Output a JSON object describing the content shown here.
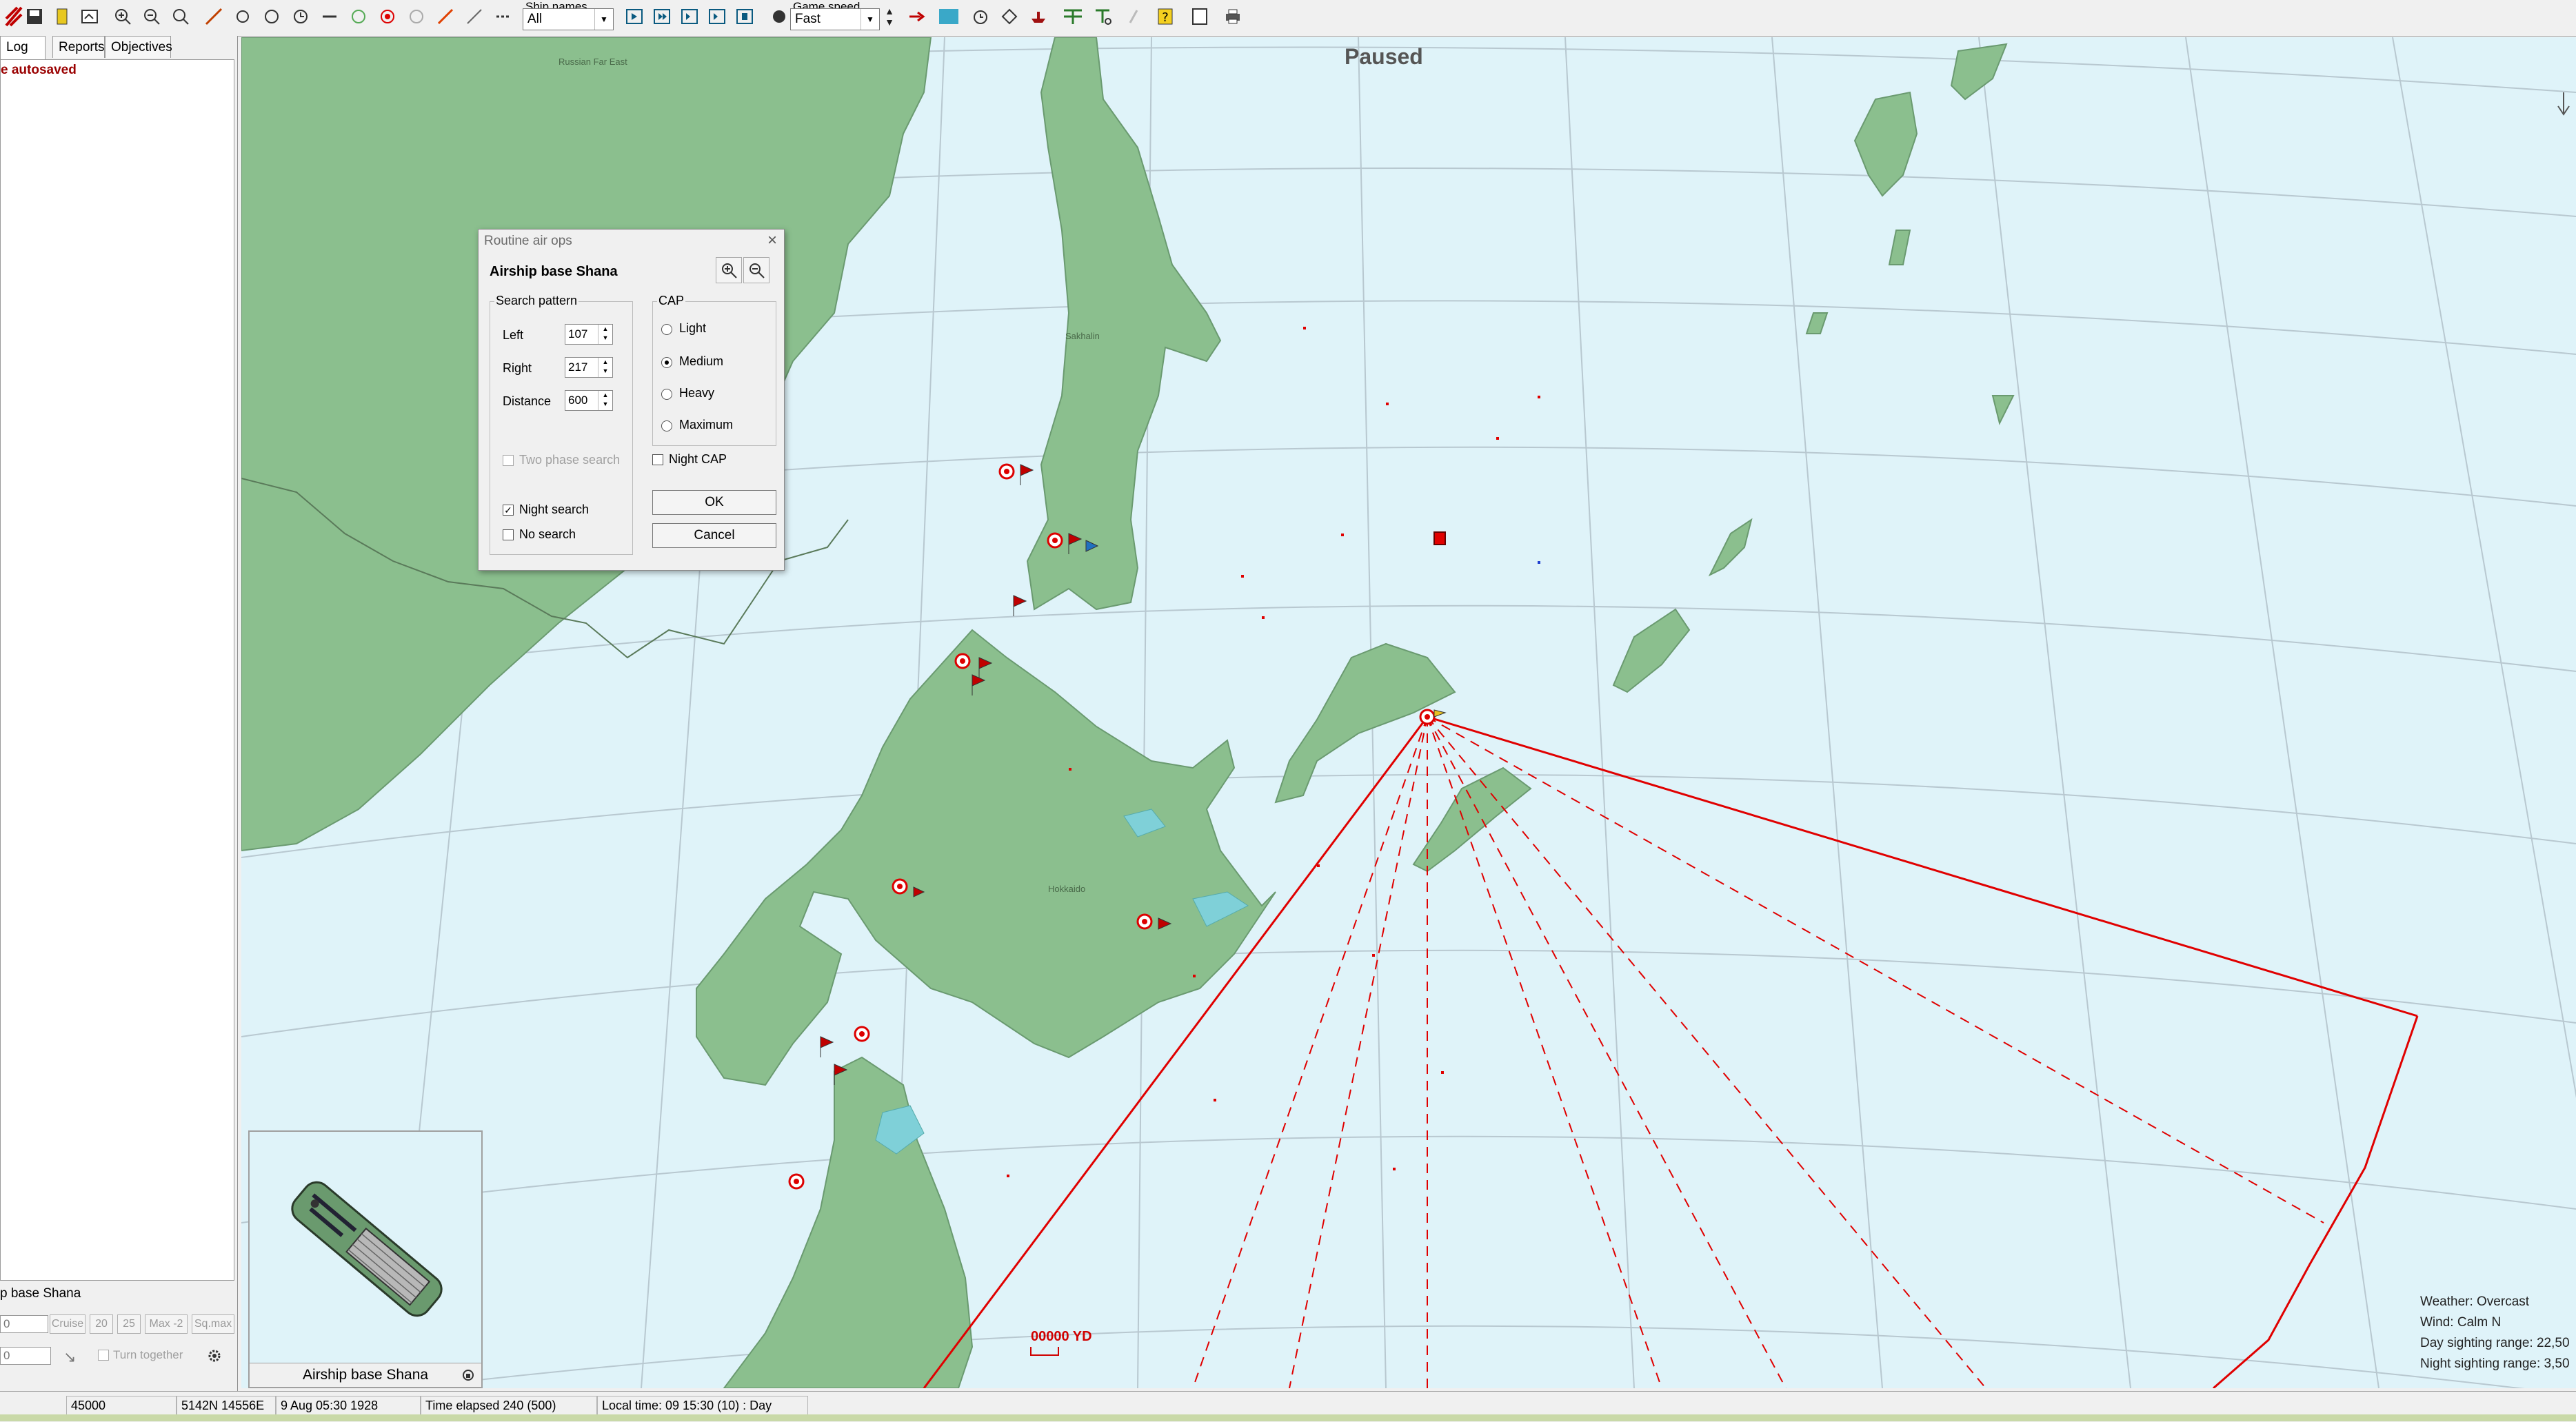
{
  "toolbar": {
    "ship_names_label": "Ship names",
    "ship_names_value": "All",
    "game_speed_label": "Game speed",
    "game_speed_value": "Fast"
  },
  "left_panel": {
    "tabs": [
      {
        "label": "Log",
        "active": true
      },
      {
        "label": "Reports",
        "active": false
      },
      {
        "label": "Objectives",
        "active": false
      }
    ],
    "log_line": "e autosaved",
    "unit_name": "p base Shana",
    "controls": {
      "speed_value": "0",
      "cruise_label": "Cruise",
      "b20_label": "20",
      "b25_label": "25",
      "max_label": "Max -2",
      "sqmax_label": "Sq.max",
      "heading_value": "0",
      "turn_together_label": "Turn together"
    }
  },
  "map": {
    "paused_label": "Paused",
    "region_label_far_east": "Russian Far East",
    "region_label_sakhalin": "Sakhalin",
    "region_label_hokkaido": "Hokkaido",
    "scale_label": "00000 YD",
    "weather": {
      "weather": "Weather: Overcast",
      "wind": "Wind: Calm  N",
      "day_sighting": "Day sighting range: 22,50",
      "night_sighting": "Night sighting range: 3,50"
    }
  },
  "thumbnail": {
    "label": "Airship base Shana"
  },
  "dialog": {
    "title": "Routine air ops",
    "header": "Airship base Shana",
    "search_pattern": {
      "label": "Search pattern",
      "left_label": "Left",
      "left_value": "107",
      "right_label": "Right",
      "right_value": "217",
      "distance_label": "Distance",
      "distance_value": "600"
    },
    "cap": {
      "label": "CAP",
      "options": [
        "Light",
        "Medium",
        "Heavy",
        "Maximum"
      ],
      "selected": "Medium"
    },
    "two_phase_search_label": "Two phase search",
    "night_cap_label": "Night CAP",
    "night_search_label": "Night search",
    "no_search_label": "No search",
    "ok_label": "OK",
    "cancel_label": "Cancel"
  },
  "statusbar": {
    "value": "45000",
    "coords": "5142N 14556E",
    "date": "9 Aug 05:30 1928",
    "elapsed": "Time elapsed 240 (500)",
    "local_time": "Local time: 09 15:30 (10) : Day"
  },
  "colors": {
    "sea": "#dff3f9",
    "land": "#8bbf8e",
    "search_line": "#e00000"
  }
}
